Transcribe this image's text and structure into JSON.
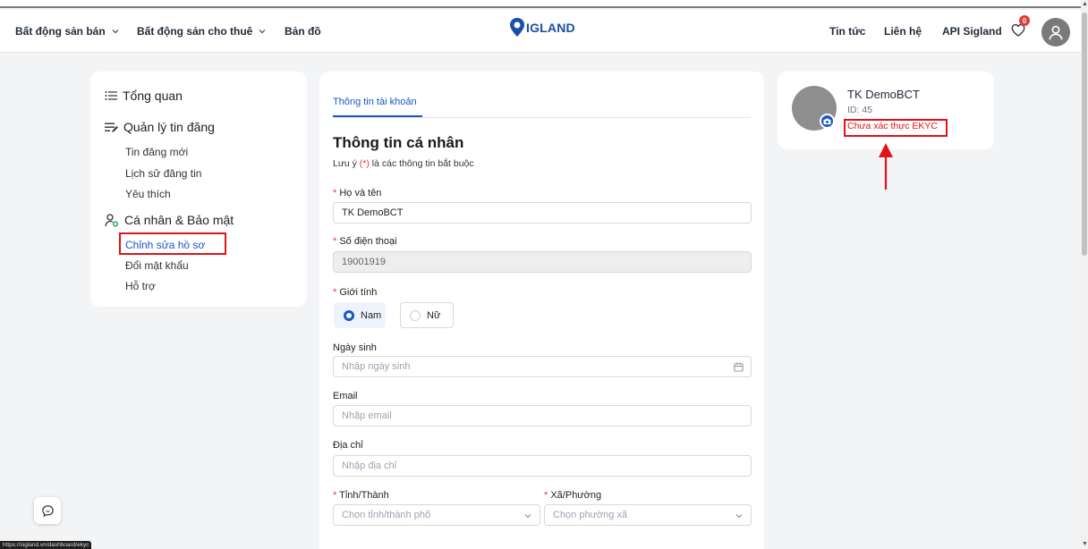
{
  "header": {
    "nav_left": [
      {
        "label": "Bất động sản bán",
        "has_dropdown": true
      },
      {
        "label": "Bất động sản cho thuê",
        "has_dropdown": true
      },
      {
        "label": "Bản đồ",
        "has_dropdown": false
      }
    ],
    "logo_text": "IGLAND",
    "logo_icon": "map-pin-icon",
    "nav_right": [
      "Tin tức",
      "Liên hệ",
      "API Sigland"
    ],
    "favorites_count": "0",
    "brand_color": "#1a4fa8"
  },
  "sidebar": {
    "overview": "Tổng quan",
    "groups": [
      {
        "title": "Quản lý tin đăng",
        "icon": "list-edit-icon",
        "items": [
          "Tin đăng mới",
          "Lịch sử đăng tin",
          "Yêu thích"
        ]
      },
      {
        "title": "Cá nhân & Bảo mật",
        "icon": "user-settings-icon",
        "items": [
          "Chỉnh sửa hồ sơ",
          "Đổi mật khẩu",
          "Hỗ trợ"
        ]
      }
    ],
    "active_item": "Chỉnh sửa hồ sơ"
  },
  "form": {
    "tab": "Thông tin tài khoản",
    "title": "Thông tin cá nhân",
    "note_prefix": "Lưu ý ",
    "note_required": "(*)",
    "note_suffix": " là các thông tin bắt buộc",
    "required_mark": "*",
    "fields": {
      "fullname": {
        "label": "Họ và tên",
        "value": "TK DemoBCT"
      },
      "phone": {
        "label": "Số điện thoại",
        "value": "19001919"
      },
      "gender": {
        "label": "Giới tính",
        "options": [
          "Nam",
          "Nữ"
        ],
        "selected": "Nam"
      },
      "birthday": {
        "label": "Ngày sinh",
        "placeholder": "Nhập ngày sinh"
      },
      "email": {
        "label": "Email",
        "placeholder": "Nhập email"
      },
      "address": {
        "label": "Địa chỉ",
        "placeholder": "Nhập địa chỉ"
      },
      "province": {
        "label": "Tỉnh/Thành",
        "placeholder": "Chọn tỉnh/thành phố"
      },
      "ward": {
        "label": "Xã/Phường",
        "placeholder": "Chọn phường xã"
      }
    }
  },
  "profile": {
    "name": "TK DemoBCT",
    "id": "ID: 45",
    "status": "Chưa xác thực EKYC",
    "status_color": "#e0121b"
  },
  "statusbar": {
    "url": "https://sigland.vn/dashboard/ekyc"
  }
}
